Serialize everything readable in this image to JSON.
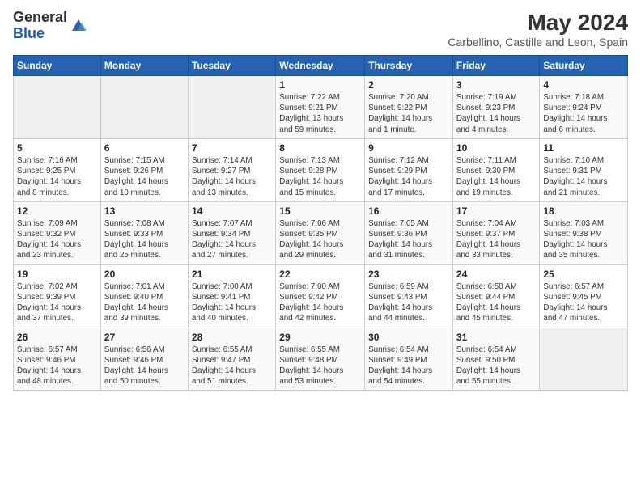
{
  "logo": {
    "general": "General",
    "blue": "Blue"
  },
  "title": "May 2024",
  "subtitle": "Carbellino, Castille and Leon, Spain",
  "headers": [
    "Sunday",
    "Monday",
    "Tuesday",
    "Wednesday",
    "Thursday",
    "Friday",
    "Saturday"
  ],
  "weeks": [
    [
      {
        "day": "",
        "info": ""
      },
      {
        "day": "",
        "info": ""
      },
      {
        "day": "",
        "info": ""
      },
      {
        "day": "1",
        "info": "Sunrise: 7:22 AM\nSunset: 9:21 PM\nDaylight: 13 hours\nand 59 minutes."
      },
      {
        "day": "2",
        "info": "Sunrise: 7:20 AM\nSunset: 9:22 PM\nDaylight: 14 hours\nand 1 minute."
      },
      {
        "day": "3",
        "info": "Sunrise: 7:19 AM\nSunset: 9:23 PM\nDaylight: 14 hours\nand 4 minutes."
      },
      {
        "day": "4",
        "info": "Sunrise: 7:18 AM\nSunset: 9:24 PM\nDaylight: 14 hours\nand 6 minutes."
      }
    ],
    [
      {
        "day": "5",
        "info": "Sunrise: 7:16 AM\nSunset: 9:25 PM\nDaylight: 14 hours\nand 8 minutes."
      },
      {
        "day": "6",
        "info": "Sunrise: 7:15 AM\nSunset: 9:26 PM\nDaylight: 14 hours\nand 10 minutes."
      },
      {
        "day": "7",
        "info": "Sunrise: 7:14 AM\nSunset: 9:27 PM\nDaylight: 14 hours\nand 13 minutes."
      },
      {
        "day": "8",
        "info": "Sunrise: 7:13 AM\nSunset: 9:28 PM\nDaylight: 14 hours\nand 15 minutes."
      },
      {
        "day": "9",
        "info": "Sunrise: 7:12 AM\nSunset: 9:29 PM\nDaylight: 14 hours\nand 17 minutes."
      },
      {
        "day": "10",
        "info": "Sunrise: 7:11 AM\nSunset: 9:30 PM\nDaylight: 14 hours\nand 19 minutes."
      },
      {
        "day": "11",
        "info": "Sunrise: 7:10 AM\nSunset: 9:31 PM\nDaylight: 14 hours\nand 21 minutes."
      }
    ],
    [
      {
        "day": "12",
        "info": "Sunrise: 7:09 AM\nSunset: 9:32 PM\nDaylight: 14 hours\nand 23 minutes."
      },
      {
        "day": "13",
        "info": "Sunrise: 7:08 AM\nSunset: 9:33 PM\nDaylight: 14 hours\nand 25 minutes."
      },
      {
        "day": "14",
        "info": "Sunrise: 7:07 AM\nSunset: 9:34 PM\nDaylight: 14 hours\nand 27 minutes."
      },
      {
        "day": "15",
        "info": "Sunrise: 7:06 AM\nSunset: 9:35 PM\nDaylight: 14 hours\nand 29 minutes."
      },
      {
        "day": "16",
        "info": "Sunrise: 7:05 AM\nSunset: 9:36 PM\nDaylight: 14 hours\nand 31 minutes."
      },
      {
        "day": "17",
        "info": "Sunrise: 7:04 AM\nSunset: 9:37 PM\nDaylight: 14 hours\nand 33 minutes."
      },
      {
        "day": "18",
        "info": "Sunrise: 7:03 AM\nSunset: 9:38 PM\nDaylight: 14 hours\nand 35 minutes."
      }
    ],
    [
      {
        "day": "19",
        "info": "Sunrise: 7:02 AM\nSunset: 9:39 PM\nDaylight: 14 hours\nand 37 minutes."
      },
      {
        "day": "20",
        "info": "Sunrise: 7:01 AM\nSunset: 9:40 PM\nDaylight: 14 hours\nand 39 minutes."
      },
      {
        "day": "21",
        "info": "Sunrise: 7:00 AM\nSunset: 9:41 PM\nDaylight: 14 hours\nand 40 minutes."
      },
      {
        "day": "22",
        "info": "Sunrise: 7:00 AM\nSunset: 9:42 PM\nDaylight: 14 hours\nand 42 minutes."
      },
      {
        "day": "23",
        "info": "Sunrise: 6:59 AM\nSunset: 9:43 PM\nDaylight: 14 hours\nand 44 minutes."
      },
      {
        "day": "24",
        "info": "Sunrise: 6:58 AM\nSunset: 9:44 PM\nDaylight: 14 hours\nand 45 minutes."
      },
      {
        "day": "25",
        "info": "Sunrise: 6:57 AM\nSunset: 9:45 PM\nDaylight: 14 hours\nand 47 minutes."
      }
    ],
    [
      {
        "day": "26",
        "info": "Sunrise: 6:57 AM\nSunset: 9:46 PM\nDaylight: 14 hours\nand 48 minutes."
      },
      {
        "day": "27",
        "info": "Sunrise: 6:56 AM\nSunset: 9:46 PM\nDaylight: 14 hours\nand 50 minutes."
      },
      {
        "day": "28",
        "info": "Sunrise: 6:55 AM\nSunset: 9:47 PM\nDaylight: 14 hours\nand 51 minutes."
      },
      {
        "day": "29",
        "info": "Sunrise: 6:55 AM\nSunset: 9:48 PM\nDaylight: 14 hours\nand 53 minutes."
      },
      {
        "day": "30",
        "info": "Sunrise: 6:54 AM\nSunset: 9:49 PM\nDaylight: 14 hours\nand 54 minutes."
      },
      {
        "day": "31",
        "info": "Sunrise: 6:54 AM\nSunset: 9:50 PM\nDaylight: 14 hours\nand 55 minutes."
      },
      {
        "day": "",
        "info": ""
      }
    ]
  ]
}
